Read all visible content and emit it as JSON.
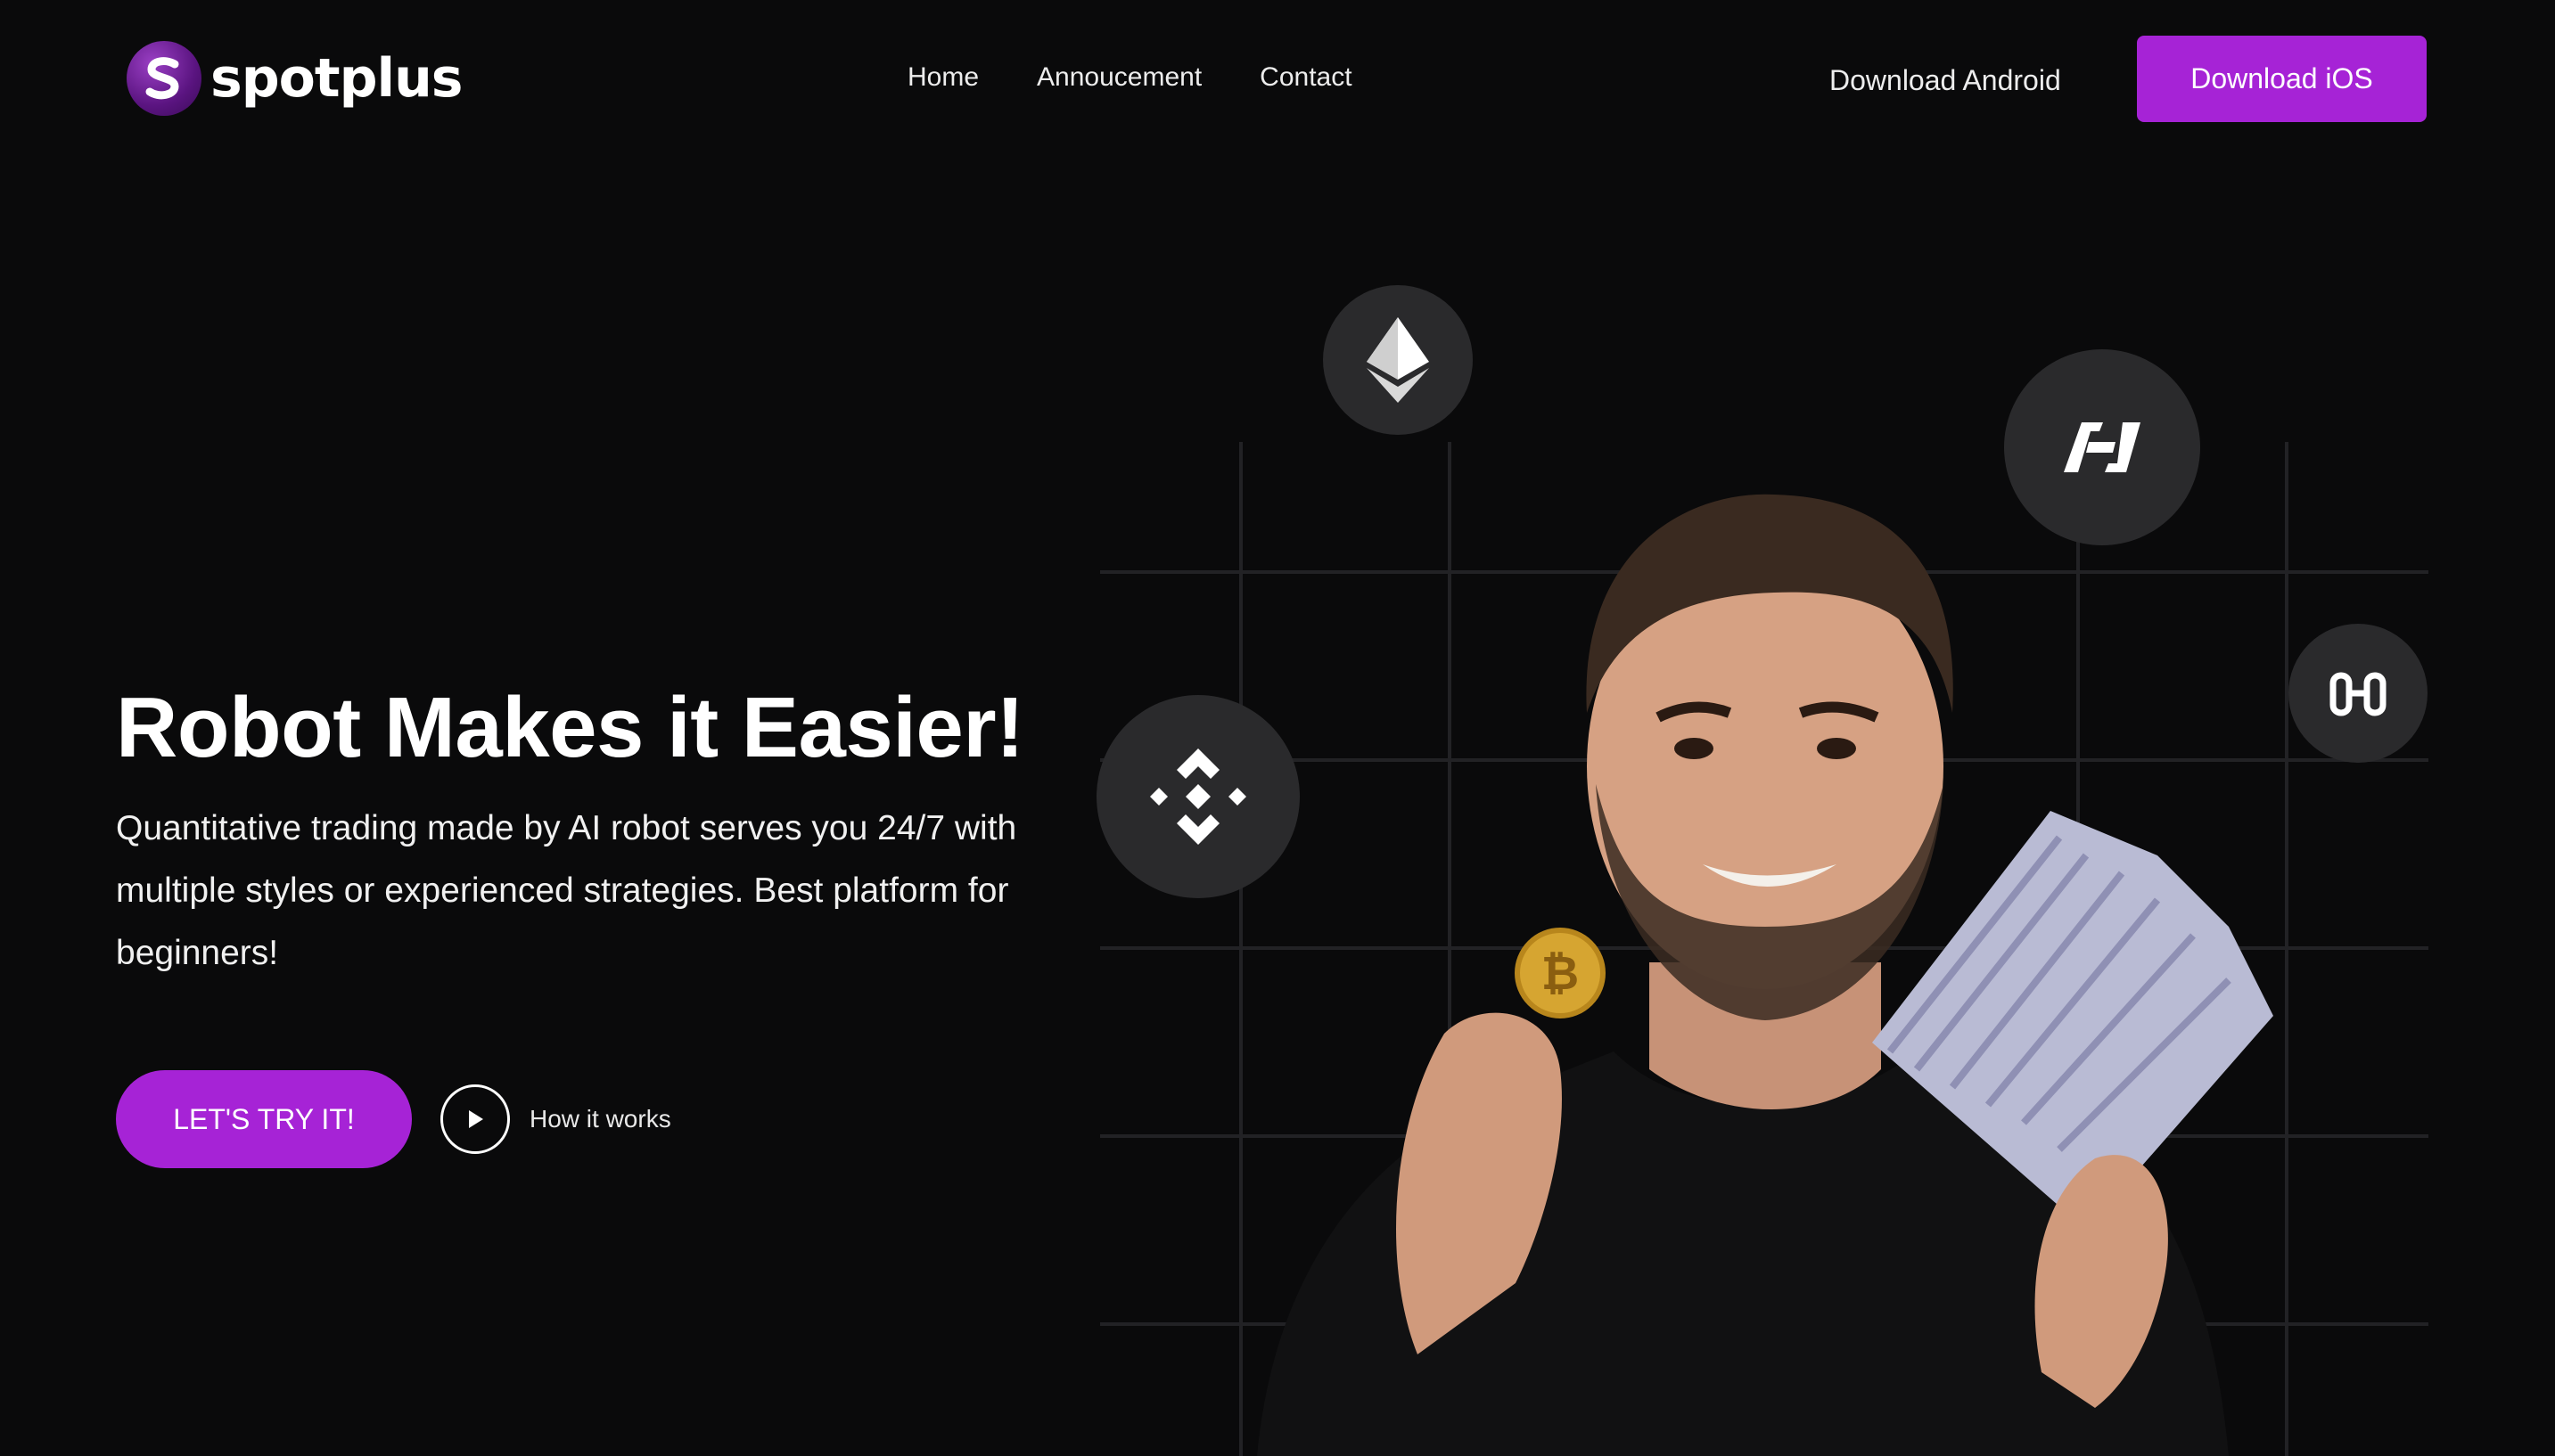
{
  "brand": {
    "name": "spotplus"
  },
  "nav": {
    "items": [
      {
        "label": "Home"
      },
      {
        "label": "Annoucement"
      },
      {
        "label": "Contact"
      }
    ]
  },
  "header": {
    "download_android": "Download Android",
    "download_ios": "Download iOS"
  },
  "hero": {
    "title": "Robot Makes it Easier!",
    "description": "Quantitative trading made by AI robot serves you 24/7 with multiple styles or experienced strategies. Best platform for beginners!",
    "cta_label": "LET'S TRY IT!",
    "how_label": "How it works"
  },
  "icons": [
    "ethereum-icon",
    "binance-icon",
    "helium-icon",
    "harmony-icon",
    "play-icon"
  ],
  "colors": {
    "background": "#0a0a0b",
    "accent": "#a623d6",
    "badge": "#2a2a2c"
  }
}
